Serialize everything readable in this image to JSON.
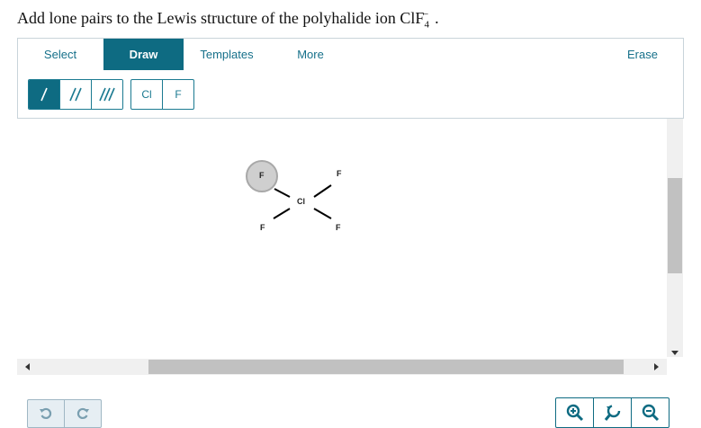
{
  "question": {
    "text": "Add lone pairs to the Lewis structure of the polyhalide ion ",
    "formula_base": "ClF",
    "formula_sub": "4",
    "formula_sup": "−",
    "end": "."
  },
  "tabs": [
    {
      "label": "Select",
      "active": false
    },
    {
      "label": "Draw",
      "active": true
    },
    {
      "label": "Templates",
      "active": false
    },
    {
      "label": "More",
      "active": false
    }
  ],
  "erase_label": "Erase",
  "bond_tools": [
    {
      "icon": "single-bond-icon",
      "active": true
    },
    {
      "icon": "double-bond-icon",
      "active": false
    },
    {
      "icon": "triple-bond-icon",
      "active": false
    }
  ],
  "atom_tools": [
    "Cl",
    "F"
  ],
  "molecule": {
    "central": "Cl",
    "ligands": [
      "F",
      "F",
      "F",
      "F"
    ],
    "selected_ligand_index": 0
  },
  "controls": {
    "undo_icon": "undo-icon",
    "redo_icon": "redo-icon",
    "zoom_in_icon": "zoom-in-icon",
    "reset_zoom_icon": "reset-zoom-icon",
    "zoom_out_icon": "zoom-out-icon"
  },
  "colors": {
    "accent": "#0e6b82",
    "tab_text": "#16708a",
    "selection": "#cfcfcf"
  }
}
